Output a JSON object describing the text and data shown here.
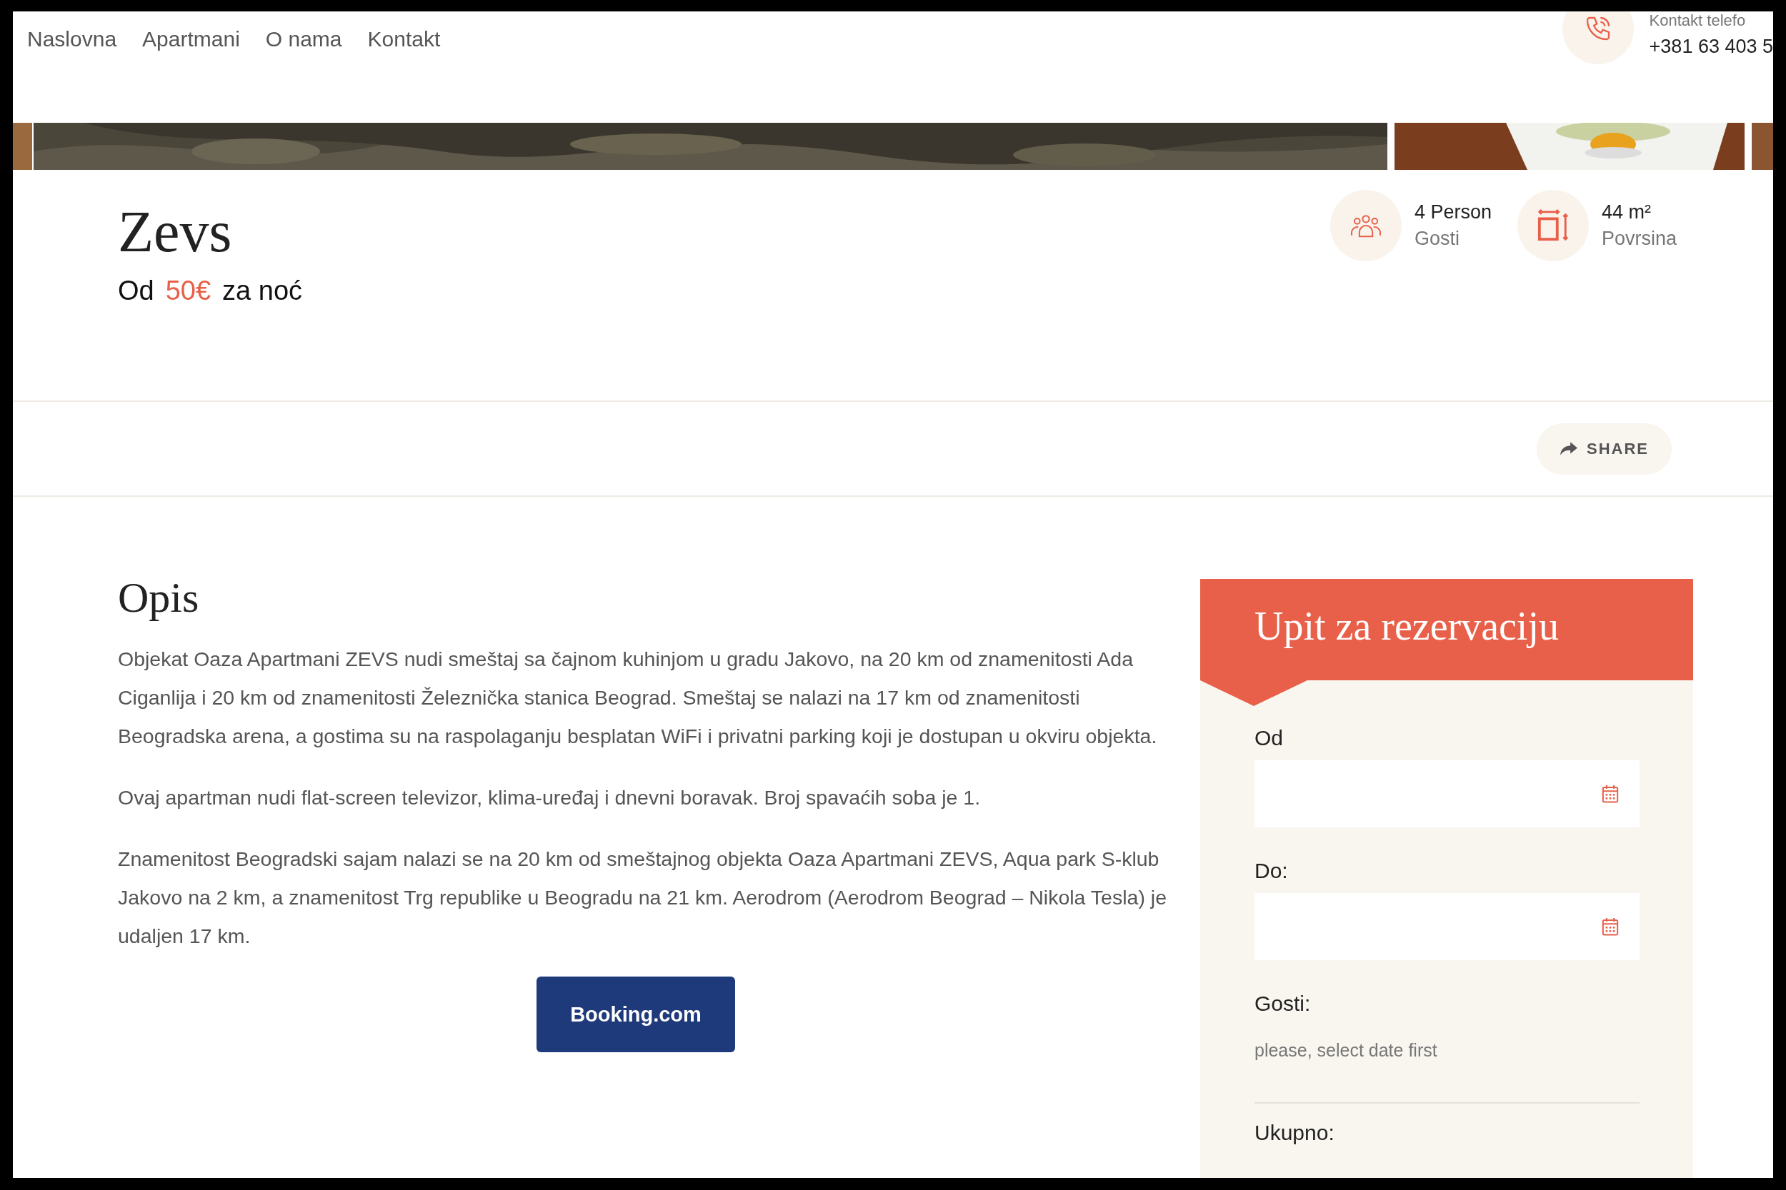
{
  "nav": {
    "items": [
      {
        "label": "Naslovna"
      },
      {
        "label": "Apartmani"
      },
      {
        "label": "O nama"
      },
      {
        "label": "Kontakt"
      }
    ],
    "contact": {
      "label": "Kontakt telefo",
      "phone": "+381 63 403 5"
    }
  },
  "room": {
    "title": "Zevs",
    "price": {
      "prefix": "Od",
      "amount": "50€",
      "suffix": "za noć"
    },
    "features": [
      {
        "kind": "guests",
        "value": "4 Person",
        "label": "Gosti"
      },
      {
        "kind": "area",
        "value": "44 m²",
        "label": "Povrsina"
      }
    ]
  },
  "share": {
    "label": "SHARE"
  },
  "description": {
    "heading": "Opis",
    "paragraphs": [
      "Objekat Oaza Apartmani ZEVS nudi smeštaj sa čajnom kuhinjom u gradu Jakovo, na 20 km od znamenitosti Ada Ciganlija i 20 km od znamenitosti Železnička stanica Beograd. Smeštaj se nalazi na 17 km od znamenitosti Beogradska arena, a gostima su na raspolaganju besplatan WiFi i privatni parking koji je dostupan u okviru objekta.",
      "Ovaj apartman nudi flat-screen televizor, klima-uređaj i dnevni boravak. Broj spavaćih soba je 1.",
      "Znamenitost Beogradski sajam nalazi se na 20 km od smeštajnog objekta Oaza Apartmani ZEVS, Aqua park S-klub Jakovo na 2 km, a znamenitost Trg republike u Beogradu na 21 km. Aerodrom (Aerodrom Beograd – Nikola Tesla) je udaljen 17 km."
    ],
    "button": "Booking.com"
  },
  "inquiry": {
    "title": "Upit za rezervaciju",
    "fields": [
      {
        "kind": "date",
        "label": "Od"
      },
      {
        "kind": "date",
        "label": "Do:"
      },
      {
        "kind": "note",
        "label": "Gosti:",
        "note": "please, select date first"
      }
    ],
    "total_label": "Ukupno:"
  }
}
